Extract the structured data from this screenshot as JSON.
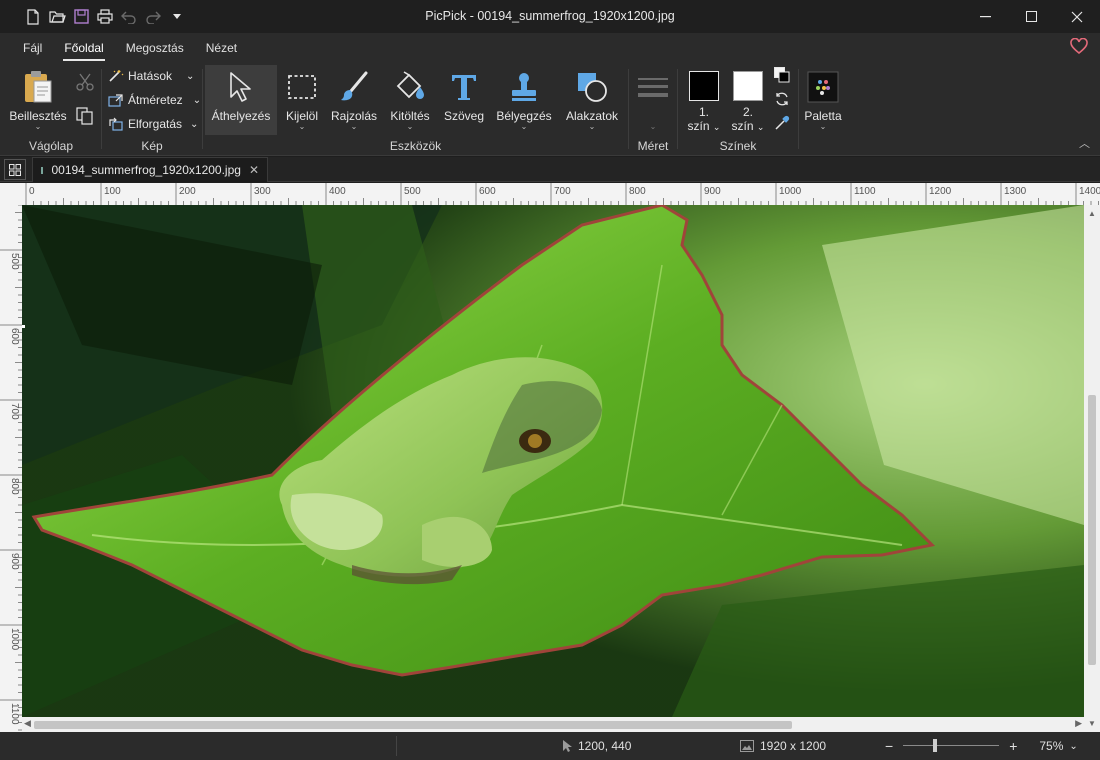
{
  "window": {
    "title": "PicPick - 00194_summerfrog_1920x1200.jpg"
  },
  "menu": {
    "tabs": [
      "Fájl",
      "Főoldal",
      "Megosztás",
      "Nézet"
    ],
    "active_tab": "Főoldal"
  },
  "ribbon": {
    "clipboard": {
      "group_label": "Vágólap",
      "paste_label": "Beillesztés"
    },
    "image": {
      "group_label": "Kép",
      "effects_label": "Hatások",
      "resize_label": "Átméretez",
      "rotate_label": "Elforgatás"
    },
    "tools": {
      "group_label": "Eszközök",
      "items": [
        "Áthelyezés",
        "Kijelöl",
        "Rajzolás",
        "Kitöltés",
        "Szöveg",
        "Bélyegzés",
        "Alakzatok"
      ],
      "active_item": "Áthelyezés"
    },
    "size": {
      "group_label": "Méret"
    },
    "colors": {
      "group_label": "Színek",
      "color1_num": "1.",
      "color1_label": "szín",
      "color2_num": "2.",
      "color2_label": "szín",
      "color1_value": "#000000",
      "color2_value": "#ffffff"
    },
    "palette": {
      "label": "Paletta"
    }
  },
  "document": {
    "tab_name": "00194_summerfrog_1920x1200.jpg",
    "image_description_icons": "frog-on-leaf-photo"
  },
  "rulers": {
    "horizontal": [
      "0",
      "100",
      "200",
      "300",
      "400",
      "500",
      "600",
      "700",
      "800",
      "900",
      "1000",
      "1100",
      "1200",
      "1300",
      "1400"
    ],
    "vertical": [
      "500",
      "600",
      "700",
      "800",
      "900",
      "1000",
      "1100"
    ]
  },
  "status": {
    "cursor_position": "1200, 440",
    "image_size": "1920 x 1200",
    "zoom": "75%",
    "zoom_minus": "−",
    "zoom_plus": "+"
  },
  "colors": {
    "accent": "#e8e8e8",
    "heart": "#e46a7a",
    "background": "#1e1e1e"
  }
}
